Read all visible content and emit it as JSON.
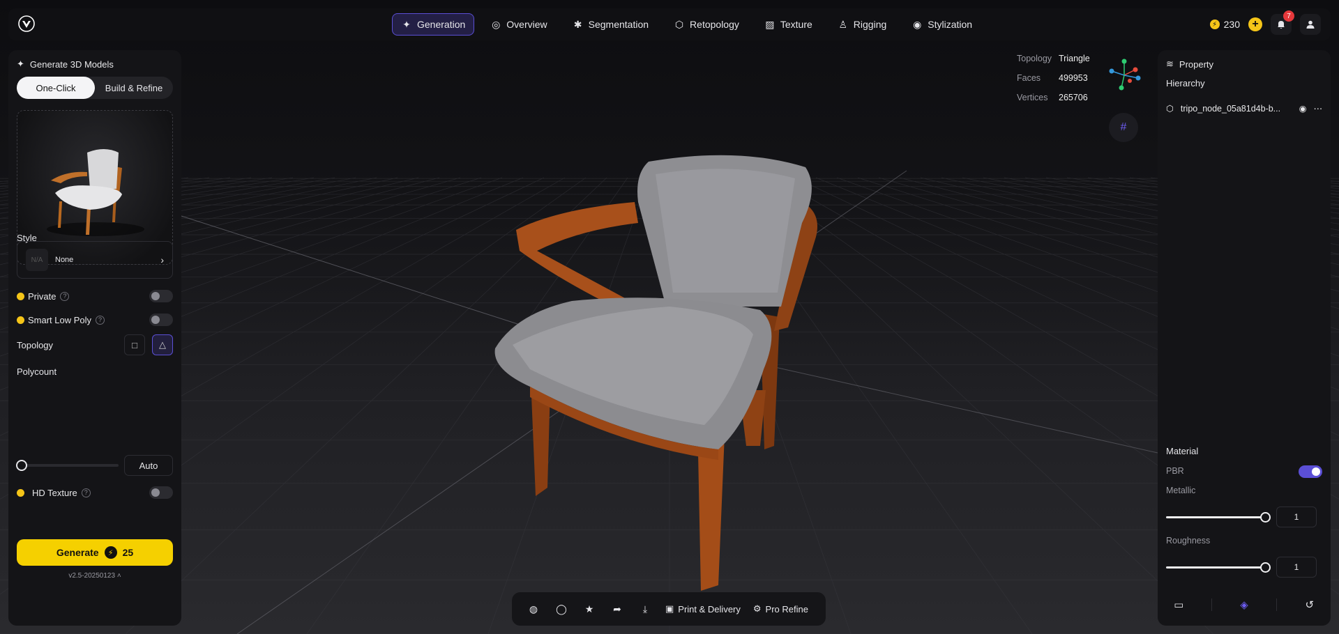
{
  "nav": {
    "items": [
      {
        "label": "Generation",
        "icon": "sparkle-icon",
        "glyph": "✦"
      },
      {
        "label": "Overview",
        "icon": "overview-icon",
        "glyph": "◎"
      },
      {
        "label": "Segmentation",
        "icon": "segmentation-icon",
        "glyph": "✱"
      },
      {
        "label": "Retopology",
        "icon": "retopology-icon",
        "glyph": "⬡"
      },
      {
        "label": "Texture",
        "icon": "texture-icon",
        "glyph": "▨"
      },
      {
        "label": "Rigging",
        "icon": "rigging-icon",
        "glyph": "♙"
      },
      {
        "label": "Stylization",
        "icon": "palette-icon",
        "glyph": "◉"
      }
    ],
    "active": "Generation"
  },
  "topright": {
    "credits": "230",
    "notifications": "7"
  },
  "left": {
    "title": "Generate 3D Models",
    "modes": [
      "One-Click",
      "Build & Refine"
    ],
    "style_label": "Style",
    "style_thumb": "N/A",
    "style_value": "None",
    "private_label": "Private",
    "lowpoly_label": "Smart Low Poly",
    "topology_label": "Topology",
    "polycount_label": "Polycount",
    "auto_label": "Auto",
    "hdtexture_label": "HD Texture",
    "version": "v2.5-20250123",
    "generate_label": "Generate",
    "generate_cost": "25"
  },
  "stats": {
    "topology_k": "Topology",
    "topology_v": "Triangle",
    "faces_k": "Faces",
    "faces_v": "499953",
    "vertices_k": "Vertices",
    "vertices_v": "265706"
  },
  "right": {
    "title": "Property",
    "hierarchy": "Hierarchy",
    "node_name": "tripo_node_05a81d4b-b...",
    "material": "Material",
    "pbr": "PBR",
    "metallic": "Metallic",
    "metallic_value": "1",
    "roughness": "Roughness",
    "roughness_value": "1"
  },
  "toolbar": {
    "print_label": "Print & Delivery",
    "refine_label": "Pro Refine"
  },
  "colors": {
    "accent": "#5b4fd6",
    "cta": "#f5d000",
    "coin": "#f5c518"
  }
}
